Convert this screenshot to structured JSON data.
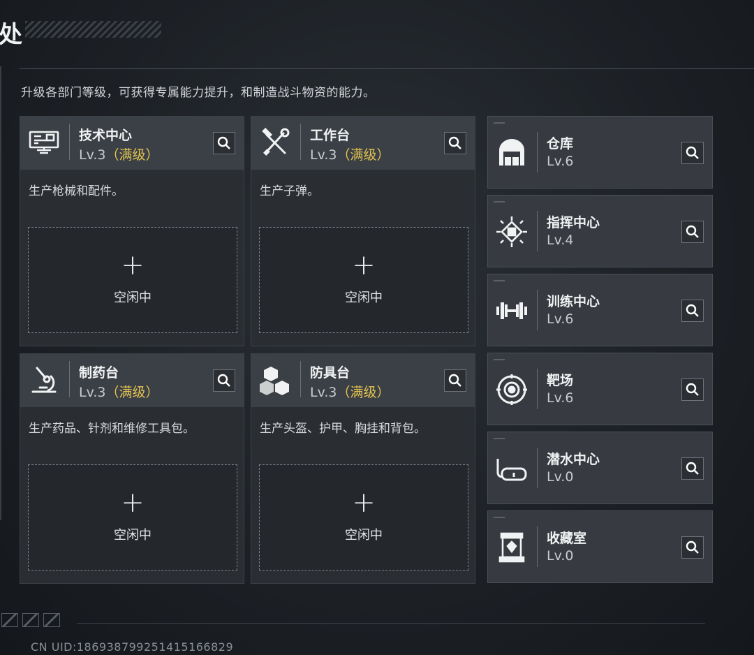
{
  "header": {
    "title_fragment": "处",
    "description": "升级各部门等级，可获得专属能力提升，和制造战斗物资的能力。"
  },
  "workshops": [
    {
      "name": "技术中心",
      "level": "Lv.3",
      "max_tag": "（满级）",
      "description": "生产枪械和配件。",
      "slot_plus": "+",
      "slot_status": "空闲中",
      "icon": "computer-terminal-icon"
    },
    {
      "name": "工作台",
      "level": "Lv.3",
      "max_tag": "（满级）",
      "description": "生产子弹。",
      "slot_plus": "+",
      "slot_status": "空闲中",
      "icon": "hammer-wrench-icon"
    },
    {
      "name": "制药台",
      "level": "Lv.3",
      "max_tag": "（满级）",
      "description": "生产药品、针剂和维修工具包。",
      "slot_plus": "+",
      "slot_status": "空闲中",
      "icon": "microscope-icon"
    },
    {
      "name": "防具台",
      "level": "Lv.3",
      "max_tag": "（满级）",
      "description": "生产头盔、护甲、胸挂和背包。",
      "slot_plus": "+",
      "slot_status": "空闲中",
      "icon": "crates-icon"
    }
  ],
  "facilities": [
    {
      "name": "仓库",
      "level": "Lv.6",
      "icon": "warehouse-icon"
    },
    {
      "name": "指挥中心",
      "level": "Lv.4",
      "icon": "chip-icon"
    },
    {
      "name": "训练中心",
      "level": "Lv.6",
      "icon": "dumbbell-icon"
    },
    {
      "name": "靶场",
      "level": "Lv.6",
      "icon": "target-icon"
    },
    {
      "name": "潜水中心",
      "level": "Lv.0",
      "icon": "diving-mask-icon"
    },
    {
      "name": "收藏室",
      "level": "Lv.0",
      "icon": "display-case-icon"
    }
  ],
  "footer": {
    "uid": "CN UID:186938799251415166829"
  },
  "colors": {
    "max_level": "#e2c24f",
    "card_bg": "#2a2e33",
    "card_header": "#3b4046",
    "row_bg": "#373b41"
  }
}
